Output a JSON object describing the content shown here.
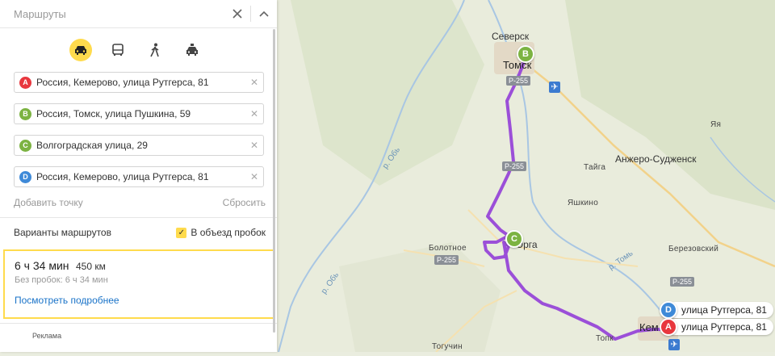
{
  "panel": {
    "title": "Маршруты",
    "close_icon": "close-icon",
    "collapse_icon": "chevron-up-icon",
    "modes": [
      {
        "name": "car",
        "icon": "car-icon",
        "active": true
      },
      {
        "name": "bus",
        "icon": "bus-icon",
        "active": false
      },
      {
        "name": "walk",
        "icon": "walk-icon",
        "active": false
      },
      {
        "name": "taxi",
        "icon": "taxi-icon",
        "active": false
      }
    ],
    "waypoints": [
      {
        "letter": "A",
        "value": "Россия, Кемерово, улица Рутгерса, 81",
        "color": "#e8373e"
      },
      {
        "letter": "B",
        "value": "Россия, Томск, улица Пушкина, 59",
        "color": "#7cb342"
      },
      {
        "letter": "C",
        "value": "Волгоградская улица, 29",
        "color": "#7cb342"
      },
      {
        "letter": "D",
        "value": "Россия, Кемерово, улица Рутгерса, 81",
        "color": "#3f8ad8"
      }
    ],
    "add_point": "Добавить точку",
    "reset": "Сбросить",
    "variants_label": "Варианты маршрутов",
    "avoid_traffic": {
      "label": "В объезд пробок",
      "checked": true
    },
    "route": {
      "time": "6 ч 34 мин",
      "distance": "450 км",
      "no_traffic": "Без пробок: 6 ч 34 мин",
      "details_link": "Посмотреть подробнее"
    },
    "ad_label": "Реклама"
  },
  "map": {
    "places": {
      "seversk": "Северск",
      "tomsk": "Томск",
      "anzhero": "Анжеро-Судженск",
      "taiga": "Тайга",
      "yashkino": "Яшкино",
      "bolotnoe": "Болотное",
      "yurga": "Юрга",
      "berezovsky": "Березовский",
      "ya": "Яя",
      "topki": "Топк",
      "kemerovo": "Кем",
      "togucin": "Тогучин"
    },
    "rivers": {
      "ob1": "р. Обь",
      "ob2": "р. Обь",
      "tom": "р. Томь"
    },
    "roads": [
      "Р-255",
      "Р-255",
      "Р-255",
      "Р-255"
    ],
    "pin_labels": {
      "d": "улица Рутгерса, 81",
      "a": "улица Рутгерса, 81"
    },
    "route_color": "#9b4fd8"
  }
}
